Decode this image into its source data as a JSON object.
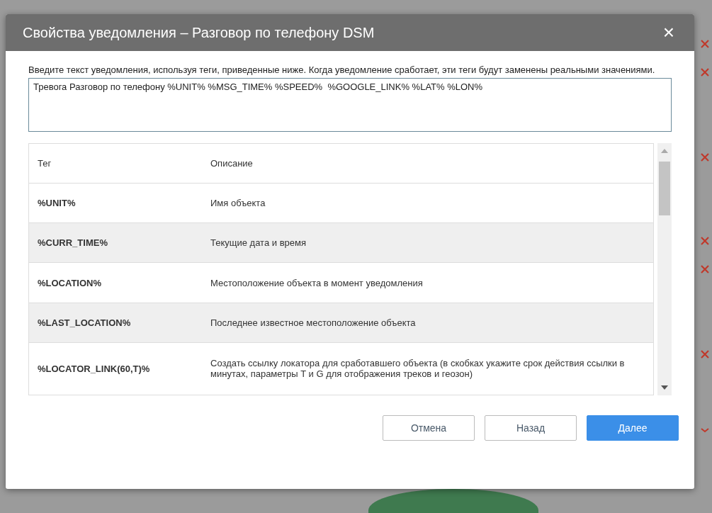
{
  "dialog": {
    "title": "Свойства уведомления – Разговор по телефону DSM",
    "close": "×",
    "instructions": "Введите текст уведомления, используя теги, приведенные ниже. Когда уведомление сработает, эти теги будут заменены реальными значениями.",
    "message": "Тревога Разговор по телефону %UNIT% %MSG_TIME% %SPEED%  %GOOGLE_LINK% %LAT% %LON%",
    "table": {
      "columns": [
        "Тег",
        "Описание"
      ],
      "rows": [
        {
          "tag": "%UNIT%",
          "description": "Имя объекта"
        },
        {
          "tag": "%CURR_TIME%",
          "description": "Текущие дата и время"
        },
        {
          "tag": "%LOCATION%",
          "description": "Местоположение объекта в момент уведомления"
        },
        {
          "tag": "%LAST_LOCATION%",
          "description": "Последнее известное местоположение объекта"
        },
        {
          "tag": "%LOCATOR_LINK(60,T)%",
          "description": "Создать ссылку локатора для сработавшего объекта (в скобках укажите срок действия ссылки в минутах, параметры T и G для отображения треков и геозон)"
        }
      ]
    },
    "buttons": [
      {
        "label": "Отмена",
        "kind": "secondary"
      },
      {
        "label": "Назад",
        "kind": "secondary"
      },
      {
        "label": "Далее",
        "kind": "primary"
      }
    ]
  }
}
